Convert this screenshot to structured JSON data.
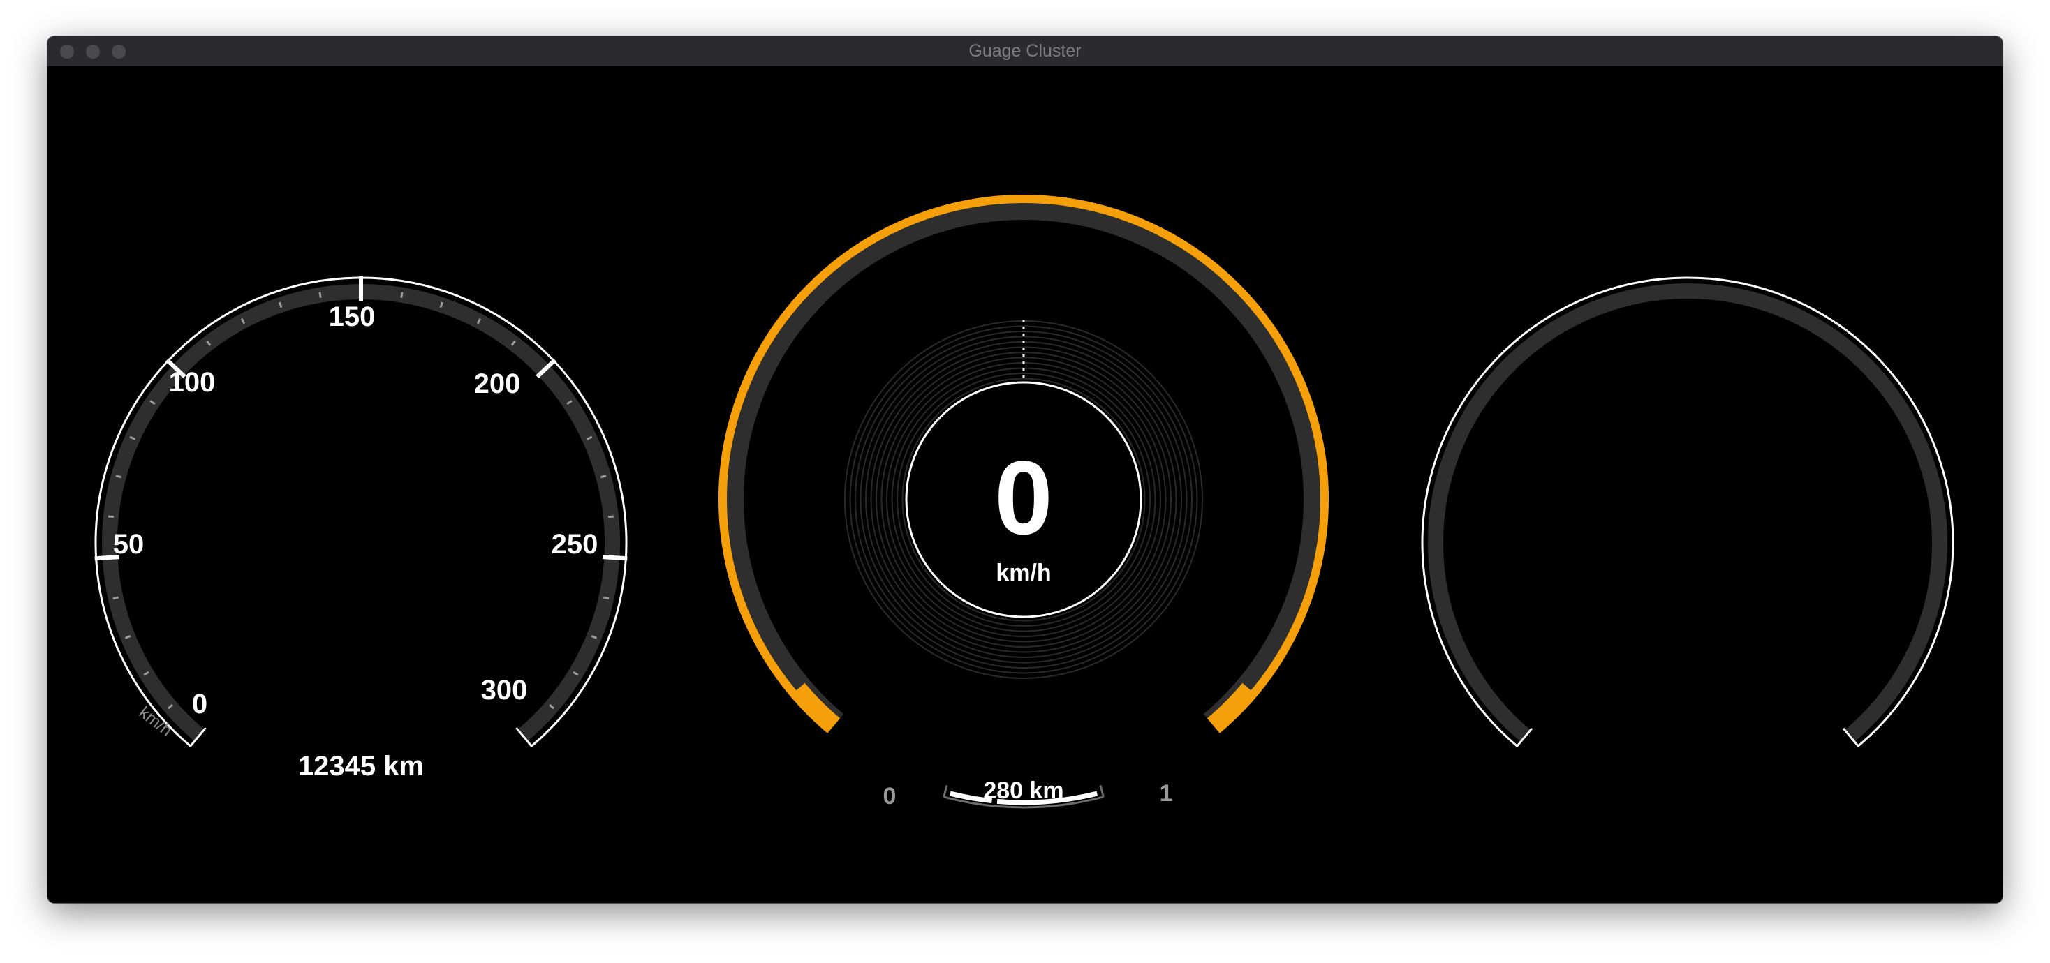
{
  "window": {
    "title": "Guage Cluster"
  },
  "colors": {
    "background": "#000000",
    "accent": "#F5A00A",
    "track": "#2e2e2e",
    "foreground": "#ffffff"
  },
  "speedometer": {
    "labels": [
      "0",
      "50",
      "100",
      "150",
      "200",
      "250",
      "300"
    ],
    "unit": "km/h",
    "odometer": "12345 km"
  },
  "center_gauge": {
    "speed": "0",
    "unit": "km/h",
    "range": "280 km",
    "range_min": "0",
    "range_max": "1",
    "range_fill": 0.5
  },
  "right_gauge": {}
}
